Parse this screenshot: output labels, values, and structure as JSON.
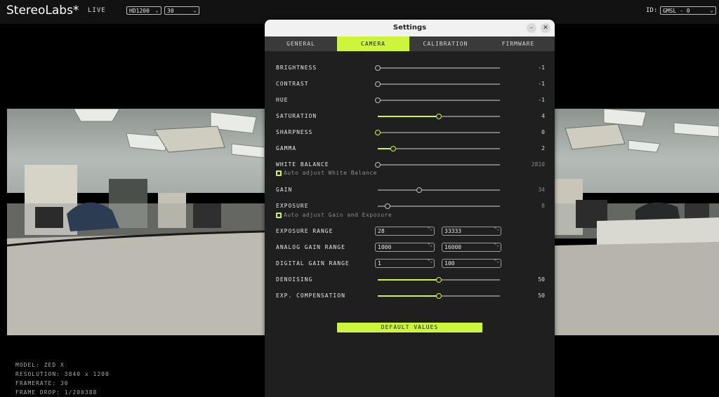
{
  "app": {
    "brand": "StereoLabs*",
    "mode": "LIVE",
    "resolution": "HD1200",
    "fps": "30",
    "id_label": "ID:",
    "id_value": "GMSL - 0"
  },
  "camera_info": {
    "model": "MODEL: ZED X",
    "resolution": "RESOLUTION: 3840 x 1200",
    "framerate": "FRAMERATE: 30",
    "frame_drop": "FRAME DROP: 1/200388"
  },
  "dialog": {
    "title": "Settings",
    "minimize_glyph": "–",
    "close_glyph": "✕",
    "tabs": [
      {
        "label": "GENERAL",
        "active": false
      },
      {
        "label": "CAMERA",
        "active": true
      },
      {
        "label": "CALIBRATION",
        "active": false
      },
      {
        "label": "FIRMWARE",
        "active": false
      }
    ],
    "sliders": {
      "brightness": {
        "label": "BRIGHTNESS",
        "value": "-1",
        "level": 0.0
      },
      "contrast": {
        "label": "CONTRAST",
        "value": "-1",
        "level": 0.0
      },
      "hue": {
        "label": "HUE",
        "value": "-1",
        "level": 0.0
      },
      "saturation": {
        "label": "SATURATION",
        "value": "4",
        "level": 0.5
      },
      "sharpness": {
        "label": "SHARPNESS",
        "value": "0",
        "level": 0.0
      },
      "gamma": {
        "label": "GAMMA",
        "value": "2",
        "level": 0.125
      },
      "white_balance": {
        "label": "WHITE BALANCE",
        "value": "2810",
        "level": 0.0
      },
      "gain": {
        "label": "GAIN",
        "value": "34",
        "level": 0.34
      },
      "exposure": {
        "label": "EXPOSURE",
        "value": "8",
        "level": 0.08
      },
      "denoising": {
        "label": "DENOISING",
        "value": "50",
        "level": 0.5
      },
      "exp_compensation": {
        "label": "EXP. COMPENSATION",
        "value": "50",
        "level": 0.5
      }
    },
    "auto_white_balance": "Auto adjust White Balance",
    "auto_gain_exposure": "Auto adjust Gain and Exposure",
    "ranges": {
      "exposure": {
        "label": "EXPOSURE RANGE",
        "min": "28",
        "max": "33333"
      },
      "analog_gain": {
        "label": "ANALOG GAIN RANGE",
        "min": "1000",
        "max": "16000"
      },
      "digital_gain": {
        "label": "DIGITAL GAIN RANGE",
        "min": "1",
        "max": "100"
      }
    },
    "default_button": "DEFAULT VALUES"
  },
  "colors": {
    "accent": "#cdf53b",
    "panel": "#1f1f1f",
    "tabbar": "#3a3a3a"
  },
  "spin_glyph": "⌃⌄"
}
